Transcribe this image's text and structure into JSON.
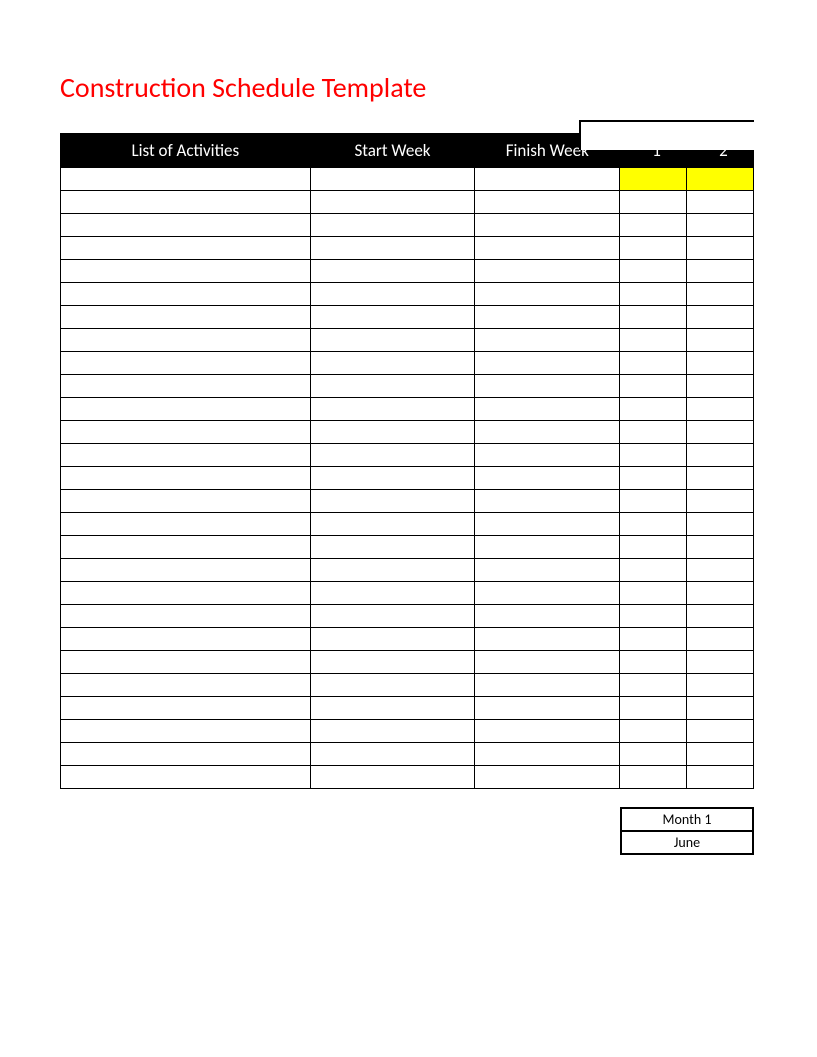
{
  "title": "Construction Schedule Template",
  "headers": {
    "activities": "List of Activities",
    "start": "Start Week",
    "finish": "Finish Week",
    "week1": "\"1",
    "week2": "\"2"
  },
  "row_count": 27,
  "month_box": {
    "label": "Month 1",
    "value": "June"
  }
}
